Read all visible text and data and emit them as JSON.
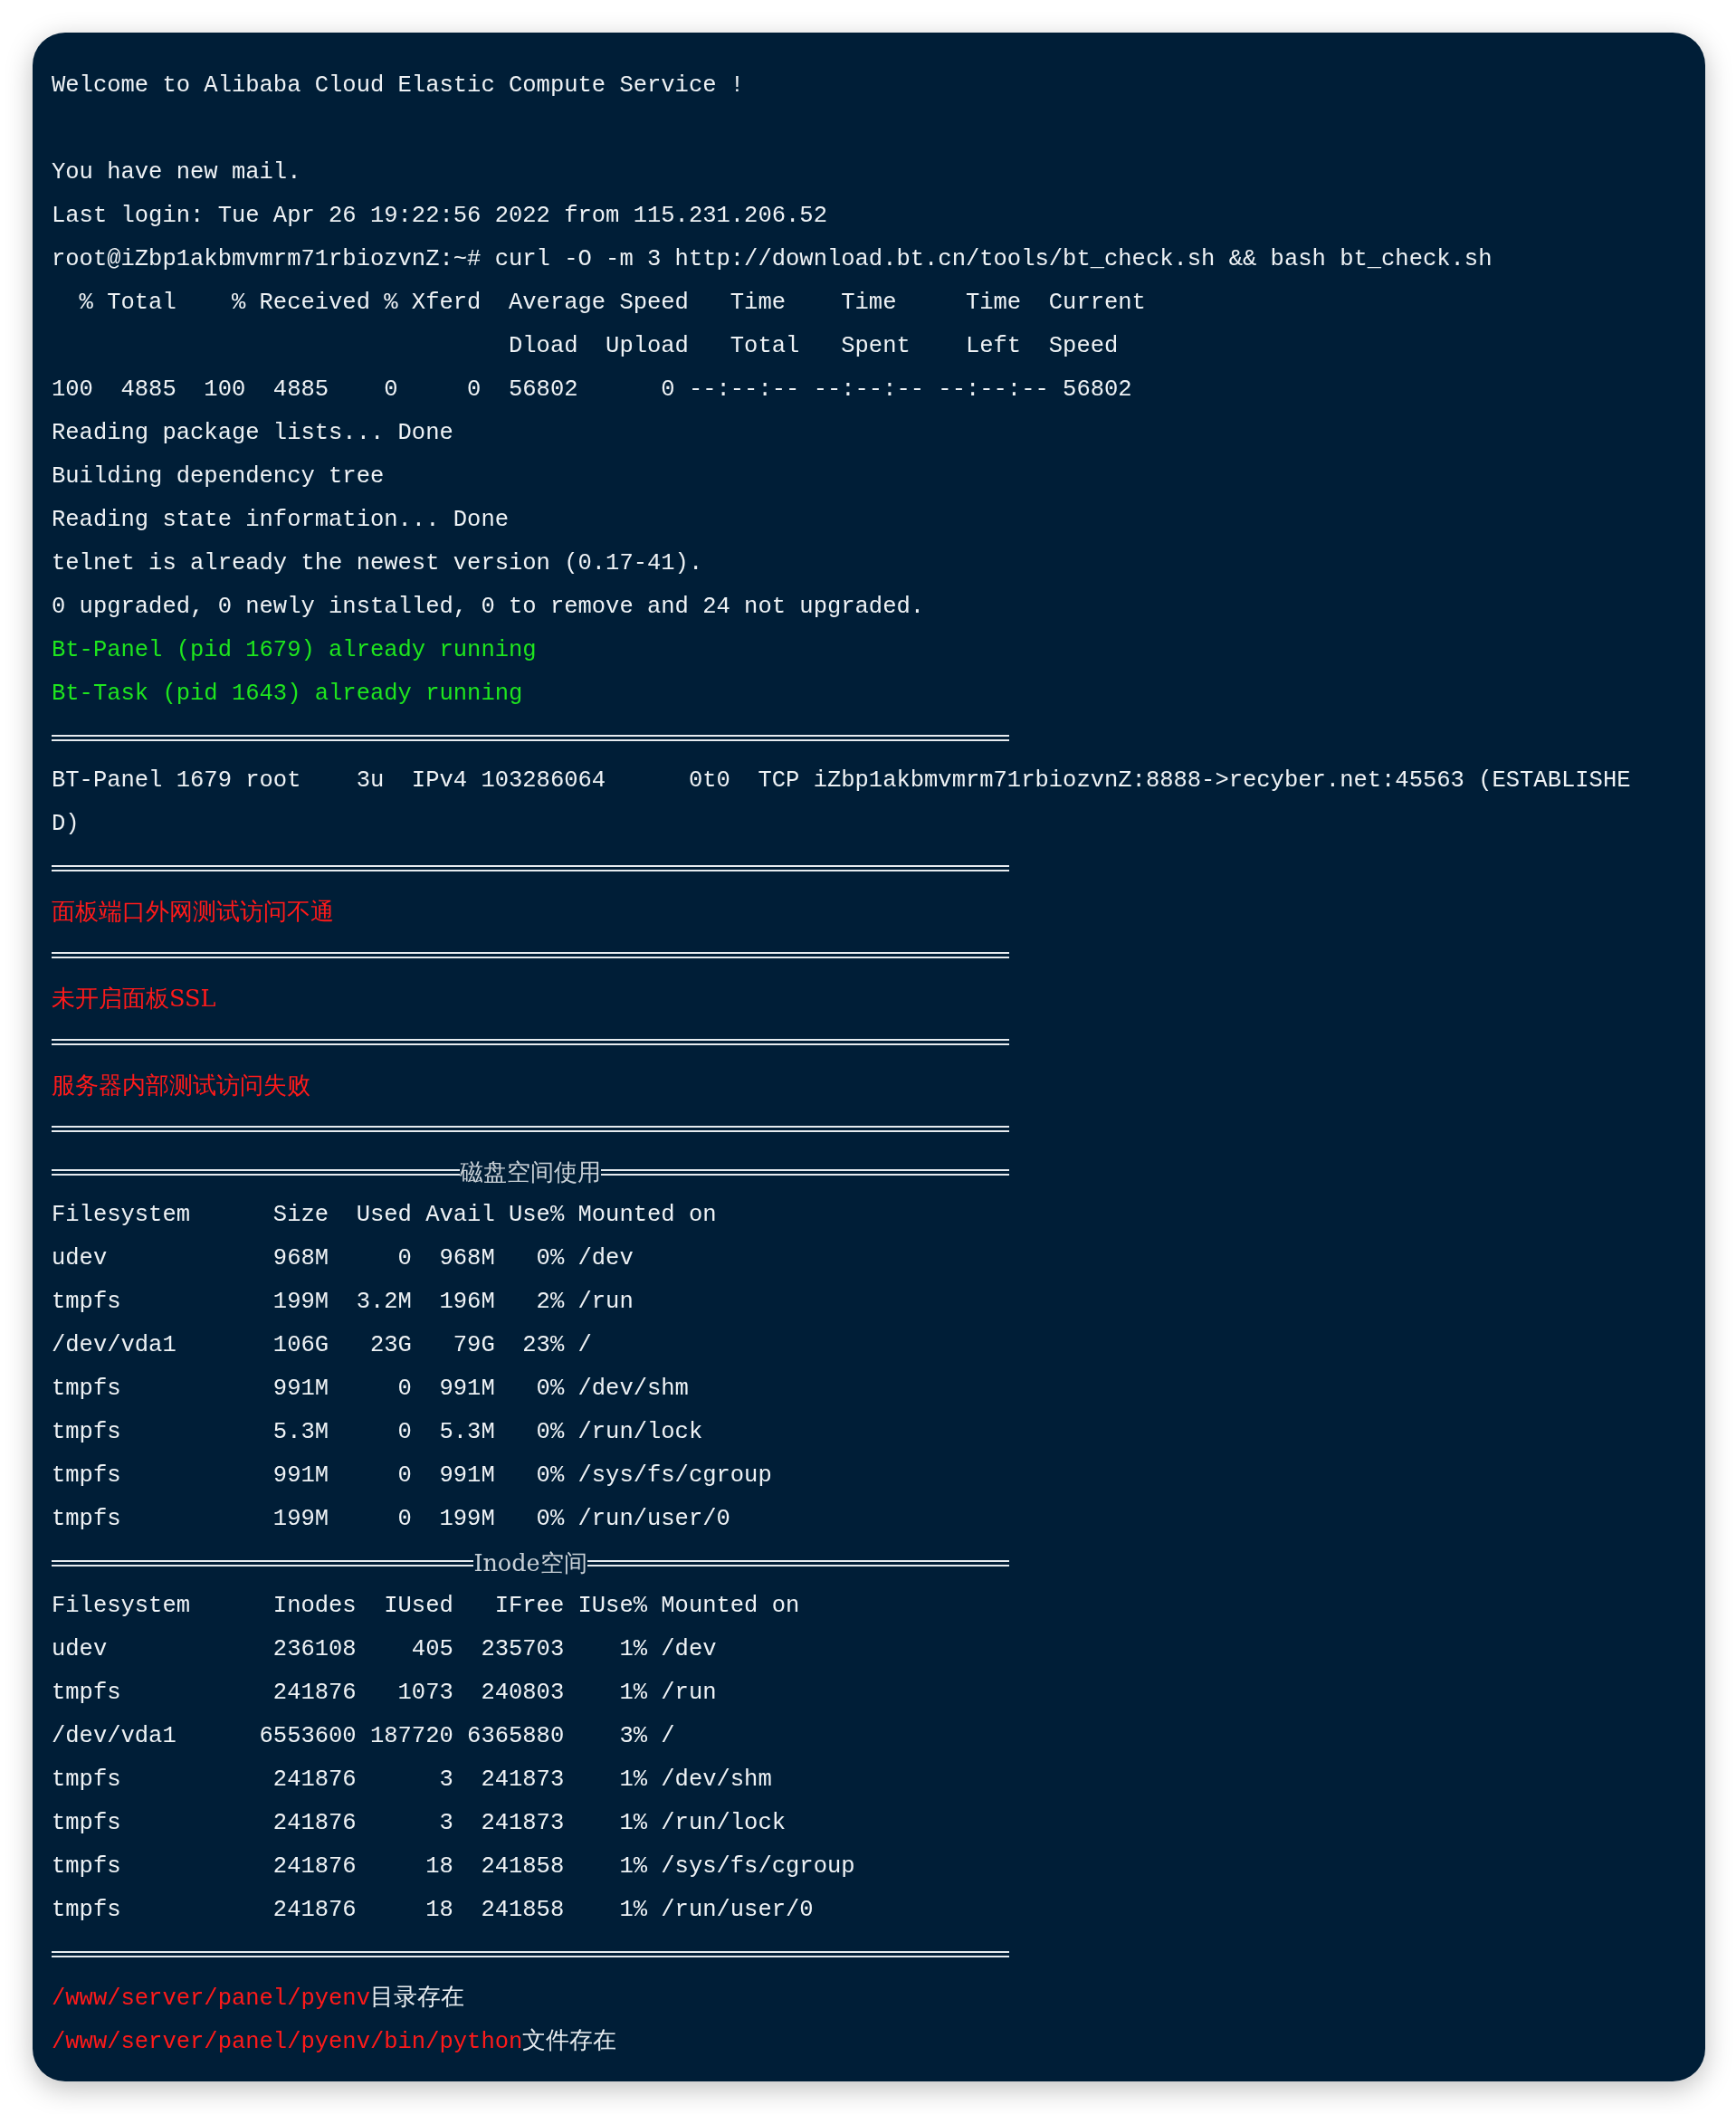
{
  "terminal": {
    "lines": [
      {
        "kind": "text",
        "text": "Welcome to Alibaba Cloud Elastic Compute Service !"
      },
      {
        "kind": "blank"
      },
      {
        "kind": "text",
        "text": "You have new mail."
      },
      {
        "kind": "text",
        "text": "Last login: Tue Apr 26 19:22:56 2022 from 115.231.206.52"
      },
      {
        "kind": "text",
        "text": "root@iZbp1akbmvmrm71rbiozvnZ:~# curl -O -m 3 http://download.bt.cn/tools/bt_check.sh && bash bt_check.sh"
      },
      {
        "kind": "text",
        "text": "  % Total    % Received % Xferd  Average Speed   Time    Time     Time  Current"
      },
      {
        "kind": "text",
        "text": "                                 Dload  Upload   Total   Spent    Left  Speed"
      },
      {
        "kind": "text",
        "text": "100  4885  100  4885    0     0  56802      0 --:--:-- --:--:-- --:--:-- 56802"
      },
      {
        "kind": "text",
        "text": "Reading package lists... Done"
      },
      {
        "kind": "text",
        "text": "Building dependency tree"
      },
      {
        "kind": "text",
        "text": "Reading state information... Done"
      },
      {
        "kind": "text",
        "text": "telnet is already the newest version (0.17-41)."
      },
      {
        "kind": "text",
        "text": "0 upgraded, 0 newly installed, 0 to remove and 24 not upgraded."
      },
      {
        "kind": "ok",
        "text": "Bt-Panel (pid 1679) already running"
      },
      {
        "kind": "ok",
        "text": "Bt-Task (pid 1643) already running"
      },
      {
        "kind": "rule"
      },
      {
        "kind": "text",
        "text": "BT-Panel 1679 root    3u  IPv4 103286064      0t0  TCP iZbp1akbmvmrm71rbiozvnZ:8888->recyber.net:45563 (ESTABLISHE"
      },
      {
        "kind": "text",
        "text": "D)"
      },
      {
        "kind": "rule"
      },
      {
        "kind": "error",
        "text": "面板端口外网测试访问不通"
      },
      {
        "kind": "rule"
      },
      {
        "kind": "error",
        "text": "未开启面板SSL"
      },
      {
        "kind": "rule"
      },
      {
        "kind": "error",
        "text": "服务器内部测试访问失败"
      },
      {
        "kind": "rule"
      },
      {
        "kind": "titled-rule",
        "text": "磁盘空间使用"
      },
      {
        "kind": "text",
        "text": "Filesystem      Size  Used Avail Use% Mounted on"
      },
      {
        "kind": "text",
        "text": "udev            968M     0  968M   0% /dev"
      },
      {
        "kind": "text",
        "text": "tmpfs           199M  3.2M  196M   2% /run"
      },
      {
        "kind": "text",
        "text": "/dev/vda1       106G   23G   79G  23% /"
      },
      {
        "kind": "text",
        "text": "tmpfs           991M     0  991M   0% /dev/shm"
      },
      {
        "kind": "text",
        "text": "tmpfs           5.3M     0  5.3M   0% /run/lock"
      },
      {
        "kind": "text",
        "text": "tmpfs           991M     0  991M   0% /sys/fs/cgroup"
      },
      {
        "kind": "text",
        "text": "tmpfs           199M     0  199M   0% /run/user/0"
      },
      {
        "kind": "titled-rule",
        "text": "Inode空间"
      },
      {
        "kind": "text",
        "text": "Filesystem      Inodes  IUsed   IFree IUse% Mounted on"
      },
      {
        "kind": "text",
        "text": "udev            236108    405  235703    1% /dev"
      },
      {
        "kind": "text",
        "text": "tmpfs           241876   1073  240803    1% /run"
      },
      {
        "kind": "text",
        "text": "/dev/vda1      6553600 187720 6365880    3% /"
      },
      {
        "kind": "text",
        "text": "tmpfs           241876      3  241873    1% /dev/shm"
      },
      {
        "kind": "text",
        "text": "tmpfs           241876      3  241873    1% /run/lock"
      },
      {
        "kind": "text",
        "text": "tmpfs           241876     18  241858    1% /sys/fs/cgroup"
      },
      {
        "kind": "text",
        "text": "tmpfs           241876     18  241858    1% /run/user/0"
      },
      {
        "kind": "rule"
      },
      {
        "kind": "mixed",
        "parts": [
          {
            "color": "#ff1a1a",
            "text": "/www/server/panel/pyenv"
          },
          {
            "color": "#e6ebef",
            "text": "目录存在"
          }
        ]
      },
      {
        "kind": "mixed",
        "parts": [
          {
            "color": "#ff1a1a",
            "text": "/www/server/panel/pyenv/bin/python"
          },
          {
            "color": "#e6ebef",
            "text": "文件存在"
          }
        ]
      }
    ]
  }
}
